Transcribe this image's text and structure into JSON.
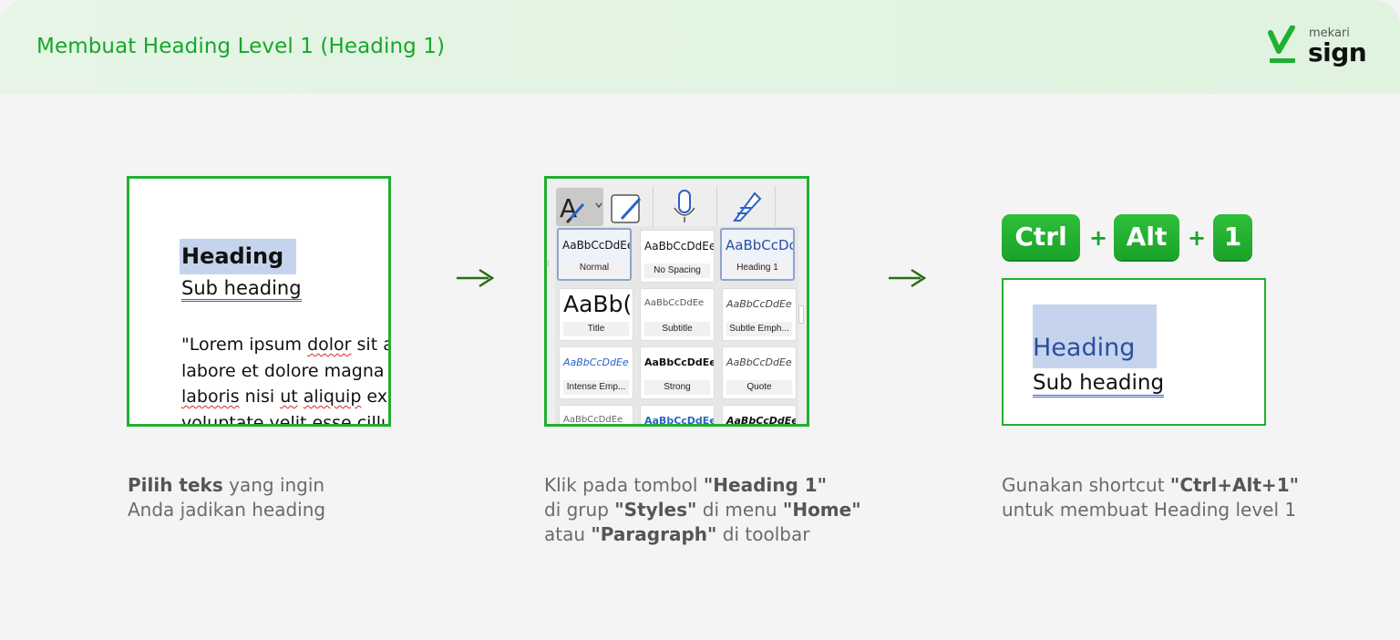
{
  "header": {
    "title": "Membuat Heading Level 1 (Heading 1)",
    "logo_small": "mekari",
    "logo_big": "sign"
  },
  "colors": {
    "accent": "#1fb02f",
    "title_green": "#17a62c",
    "highlight": "#c5d4ec",
    "heading_blue": "#2a4fa0"
  },
  "step1": {
    "heading": "Heading",
    "subheading": "Sub heading",
    "body_lines": [
      "\"Lorem ipsum dolor sit a",
      "labore et dolore magna",
      "laboris nisi ut aliquip ex",
      "voluptate velit esse cillu"
    ],
    "caption_bold": "Pilih teks",
    "caption_rest1": " yang ingin",
    "caption_line2": "Anda jadikan heading"
  },
  "step2": {
    "toolbar_icons": [
      "text-style-icon",
      "chevron-down-icon",
      "styles-pane-icon",
      "microphone-icon",
      "editor-pen-icon"
    ],
    "styles": [
      {
        "sample": "AaBbCcDdEe",
        "name": "Normal"
      },
      {
        "sample": "AaBbCcDdEe",
        "name": "No Spacing"
      },
      {
        "sample": "AaBbCcDc",
        "name": "Heading 1"
      },
      {
        "sample": "AaBb(",
        "name": "Title"
      },
      {
        "sample": "AaBbCcDdEe",
        "name": "Subtitle"
      },
      {
        "sample": "AaBbCcDdEe",
        "name": "Subtle Emph..."
      },
      {
        "sample": "AaBbCcDdEe",
        "name": "Intense Emp..."
      },
      {
        "sample": "AaBbCcDdEe",
        "name": "Strong"
      },
      {
        "sample": "AaBbCcDdEe",
        "name": "Quote"
      },
      {
        "sample": "AaBbCcDdEe",
        "name": ""
      },
      {
        "sample": "AaBbCcDdEe",
        "name": ""
      },
      {
        "sample": "AaBbCcDdEe",
        "name": ""
      }
    ],
    "caption": {
      "l1_a": "Klik pada tombol ",
      "l1_b": "\"Heading 1\"",
      "l2_a": "di grup ",
      "l2_b": "\"Styles\"",
      "l2_c": " di menu ",
      "l2_d": "\"Home\"",
      "l3_a": "atau ",
      "l3_b": "\"Paragraph\"",
      "l3_c": " di toolbar"
    }
  },
  "step3": {
    "keys": [
      "Ctrl",
      "Alt",
      "1"
    ],
    "plus": "+",
    "heading": "Heading",
    "subheading": "Sub heading",
    "caption": {
      "l1_a": "Gunakan shortcut ",
      "l1_b": "\"Ctrl+Alt+1\"",
      "l2": "untuk membuat Heading level 1"
    }
  }
}
